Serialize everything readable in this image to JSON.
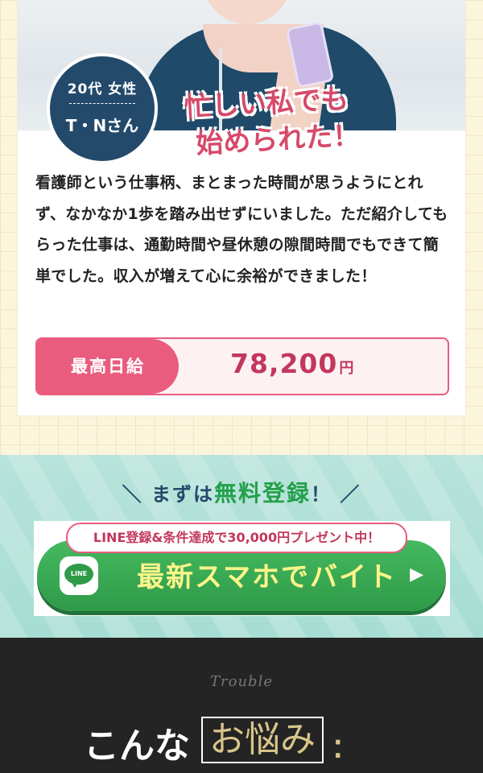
{
  "testimonial": {
    "age_gender": "20代 女性",
    "name": "T・Nさん",
    "catch_line1": "忙しい私でも",
    "catch_line2": "始められた！",
    "story": "看護師という仕事柄、まとまった時間が思うようにとれず、なかなか1歩を踏み出せずにいました。ただ紹介してもらった仕事は、通勤時間や昼休憩の隙間時間でもできて簡単でした。収入が増えて心に余裕ができました！",
    "pay_label": "最高日給",
    "pay_value": "78,200",
    "pay_unit": "円"
  },
  "cta": {
    "lead_prefix": "＼ まずは",
    "lead_highlight": "無料登録",
    "lead_suffix": "！ ／",
    "campaign": "LINE登録&条件達成で30,000円プレゼント中！",
    "line_icon_text": "LINE",
    "button_label": "最新スマホでバイト",
    "arrow": "▶",
    "colors": {
      "green": "#2f9a48",
      "pink": "#e95c7e",
      "navy": "#234a6b"
    }
  },
  "trouble_section": {
    "script": "Trouble",
    "title_prefix": "こんな",
    "title_boxed": "お悩み",
    "title_mark": "⁚"
  }
}
